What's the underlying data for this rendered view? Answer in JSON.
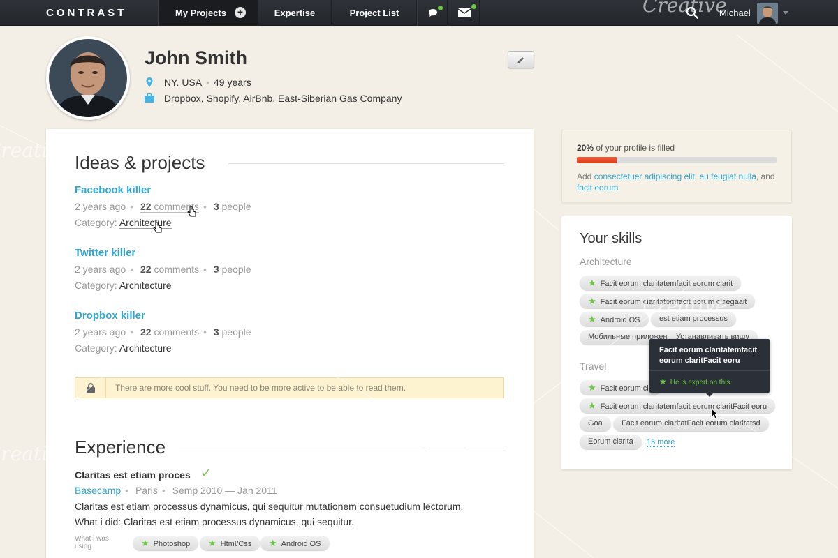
{
  "nav": {
    "brand": "CONTRAST",
    "items": [
      {
        "label": "My Projects",
        "active": true
      },
      {
        "label": "Expertise",
        "active": false
      },
      {
        "label": "Project List",
        "active": false
      }
    ],
    "plus": "+",
    "user_name": "Michael"
  },
  "profile": {
    "name": "John Smith",
    "location": "NY. USA",
    "age": "49 years",
    "companies": "Dropbox, Shopify, AirBnb, East-Siberian Gas Company"
  },
  "ideas": {
    "title": "Ideas & projects",
    "projects": [
      {
        "title": "Facebook killer",
        "time": "2 years ago",
        "comments_count": "22",
        "comments_label": "comments",
        "people_count": "3",
        "people_label": "people",
        "category_label": "Category:",
        "category": "Architecture"
      },
      {
        "title": "Twitter killer",
        "time": "2 years ago",
        "comments_count": "22",
        "comments_label": "comments",
        "people_count": "3",
        "people_label": "people",
        "category_label": "Category:",
        "category": "Architecture"
      },
      {
        "title": "Dropbox killer",
        "time": "2 years ago",
        "comments_count": "22",
        "comments_label": "comments",
        "people_count": "3",
        "people_label": "people",
        "category_label": "Category:",
        "category": "Architecture"
      }
    ],
    "notice": "There are more cool stuff. You need to be more active to be able to read them."
  },
  "experience": {
    "title": "Experience",
    "job_title": "Claritas est etiam proces",
    "company": "Basecamp",
    "city": "Paris",
    "period": "Semp 2010 — Jan 2011",
    "desc1": "Claritas est etiam processus dynamicus, qui sequitur mutationem consuetudium lectorum.",
    "desc2": "What i did: Claritas est etiam processus dynamicus, qui sequitur.",
    "used_label": "What i was using",
    "tools": [
      "Photoshop",
      "Html/Css",
      "Android OS"
    ]
  },
  "profile_fill": {
    "percent_text": "20%",
    "title_rest": "of your profile is filled",
    "progress": 0.2,
    "add_word": "Add",
    "link1": "consectetuer adipiscing elit",
    "link2": "eu feugiat nulla",
    "and_word": "and",
    "link3": "facit eorum"
  },
  "skills": {
    "title": "Your skills",
    "architecture_label": "Architecture",
    "architecture": [
      {
        "label": "Facit eorum claritatemfacit eorum clarit",
        "starred": true
      },
      {
        "label": "Facit eorum claritatemfacit eorum clsegaait",
        "starred": true
      },
      {
        "label": "Android OS",
        "starred": true
      },
      {
        "label": "est etiam processus",
        "starred": false
      },
      {
        "label": "Мобильные приложения",
        "starred": false
      },
      {
        "label": "Устанавливать вишу",
        "starred": false
      }
    ],
    "travel_label": "Travel",
    "travel": [
      {
        "label": "Facit eorum cla",
        "starred": true
      },
      {
        "label": "Facit eorum claritatemfacit eorum claritFacit eoru",
        "starred": true
      },
      {
        "label": "Goa",
        "starred": false
      },
      {
        "label": "Facit eorum claritatFacit eorum claritatsd",
        "starred": false
      },
      {
        "label": "Eorum clarita",
        "starred": false
      }
    ],
    "more": "15 more",
    "tooltip_title": "Facit eorum claritatemfacit eorum claritFacit eoru",
    "tooltip_expert": "He is expert on this"
  },
  "colors": {
    "accent": "#2fa6d4",
    "success": "#6cc644",
    "progress": "#e84b2b",
    "nav_bg": "#2a2e33",
    "page_bg": "#f3efe6"
  },
  "icons": [
    "search-icon",
    "chat-icon",
    "mail-icon",
    "location-pin-icon",
    "briefcase-icon",
    "pencil-icon",
    "lock-icon",
    "star-icon",
    "check-icon",
    "pointer-cursor-icon"
  ]
}
